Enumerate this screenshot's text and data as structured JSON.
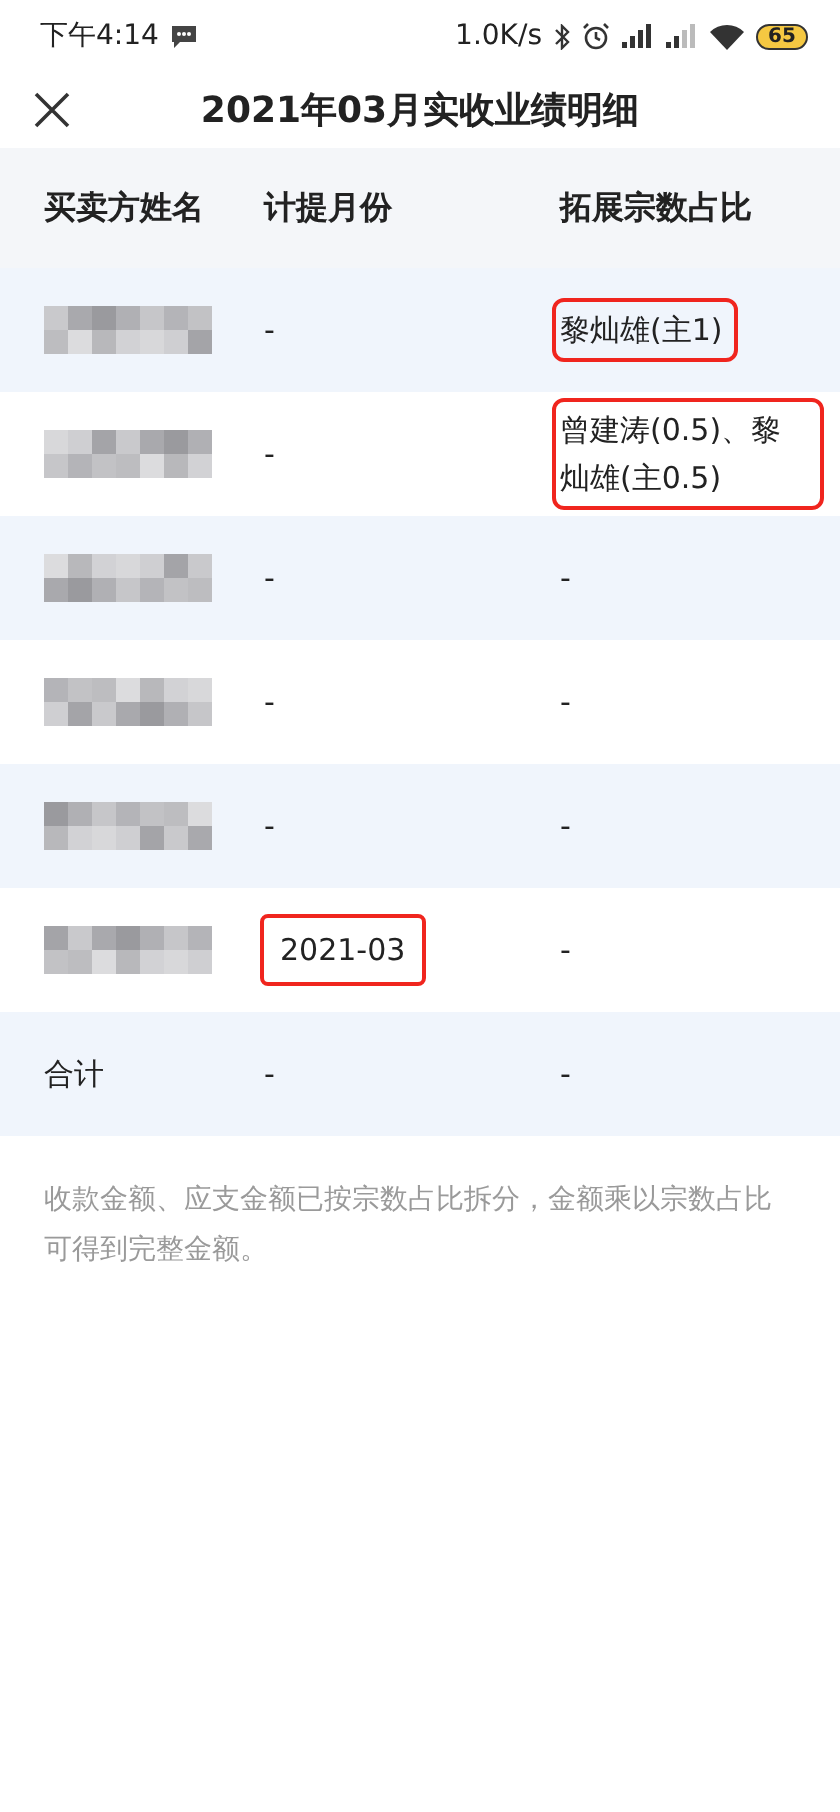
{
  "status_bar": {
    "time": "下午4:14",
    "speed": "1.0K/s",
    "battery": "65"
  },
  "header": {
    "title": "2021年03月实收业绩明细"
  },
  "table": {
    "columns": [
      "买卖方姓名",
      "计提月份",
      "拓展宗数占比"
    ],
    "rows": [
      {
        "name_blurred": true,
        "month": "-",
        "month_highlighted": false,
        "share": "黎灿雄(主1)",
        "share_highlighted": true
      },
      {
        "name_blurred": true,
        "month": "-",
        "month_highlighted": false,
        "share": "曾建涛(0.5)、黎灿雄(主0.5)",
        "share_highlighted": true
      },
      {
        "name_blurred": true,
        "month": "-",
        "month_highlighted": false,
        "share": "-",
        "share_highlighted": false
      },
      {
        "name_blurred": true,
        "month": "-",
        "month_highlighted": false,
        "share": "-",
        "share_highlighted": false
      },
      {
        "name_blurred": true,
        "month": "-",
        "month_highlighted": false,
        "share": "-",
        "share_highlighted": false
      },
      {
        "name_blurred": true,
        "month": "2021-03",
        "month_highlighted": true,
        "share": "-",
        "share_highlighted": false
      }
    ],
    "total": {
      "label": "合计",
      "month": "-",
      "share": "-"
    }
  },
  "note": "收款金额、应支金额已按宗数占比拆分，金额乘以宗数占比可得到完整金额。"
}
